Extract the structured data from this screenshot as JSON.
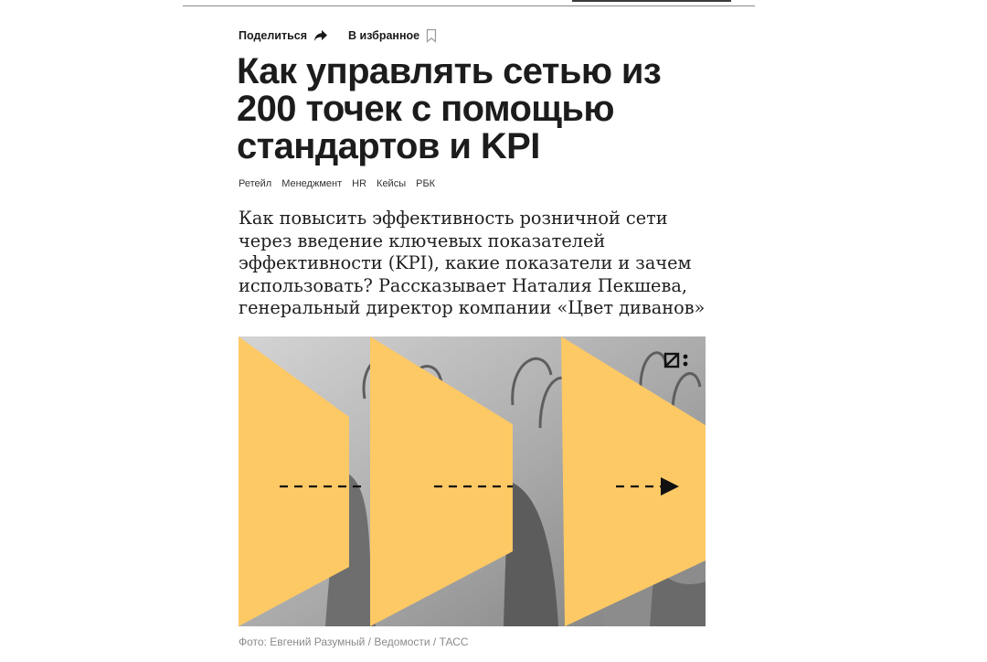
{
  "toolbar": {
    "share_label": "Поделиться",
    "favorite_label": "В избранное"
  },
  "article": {
    "title": "Как управлять сетью из 200 точек с помощью стандартов и KPI",
    "tags": [
      "Ретейл",
      "Менеджмент",
      "HR",
      "Кейсы",
      "РБК"
    ],
    "lead": "Как повысить эффективность розничной сети через введение ключевых показателей эффективности (KPI), какие показатели и зачем использовать? Рассказывает Наталия Пекшева, генеральный директор компании «Цвет диванов»",
    "photo_caption": "Фото: Евгений Разумный / Ведомости / ТАСС"
  },
  "colors": {
    "accent_yellow": "#FCC965",
    "photo_gray": "#a3a3a3",
    "text": "#1a1a1a",
    "caption_gray": "#8a8a8a"
  },
  "icons": {
    "share": "share-arrow-icon",
    "favorite": "bookmark-icon",
    "logo": "publisher-logo-icon"
  }
}
